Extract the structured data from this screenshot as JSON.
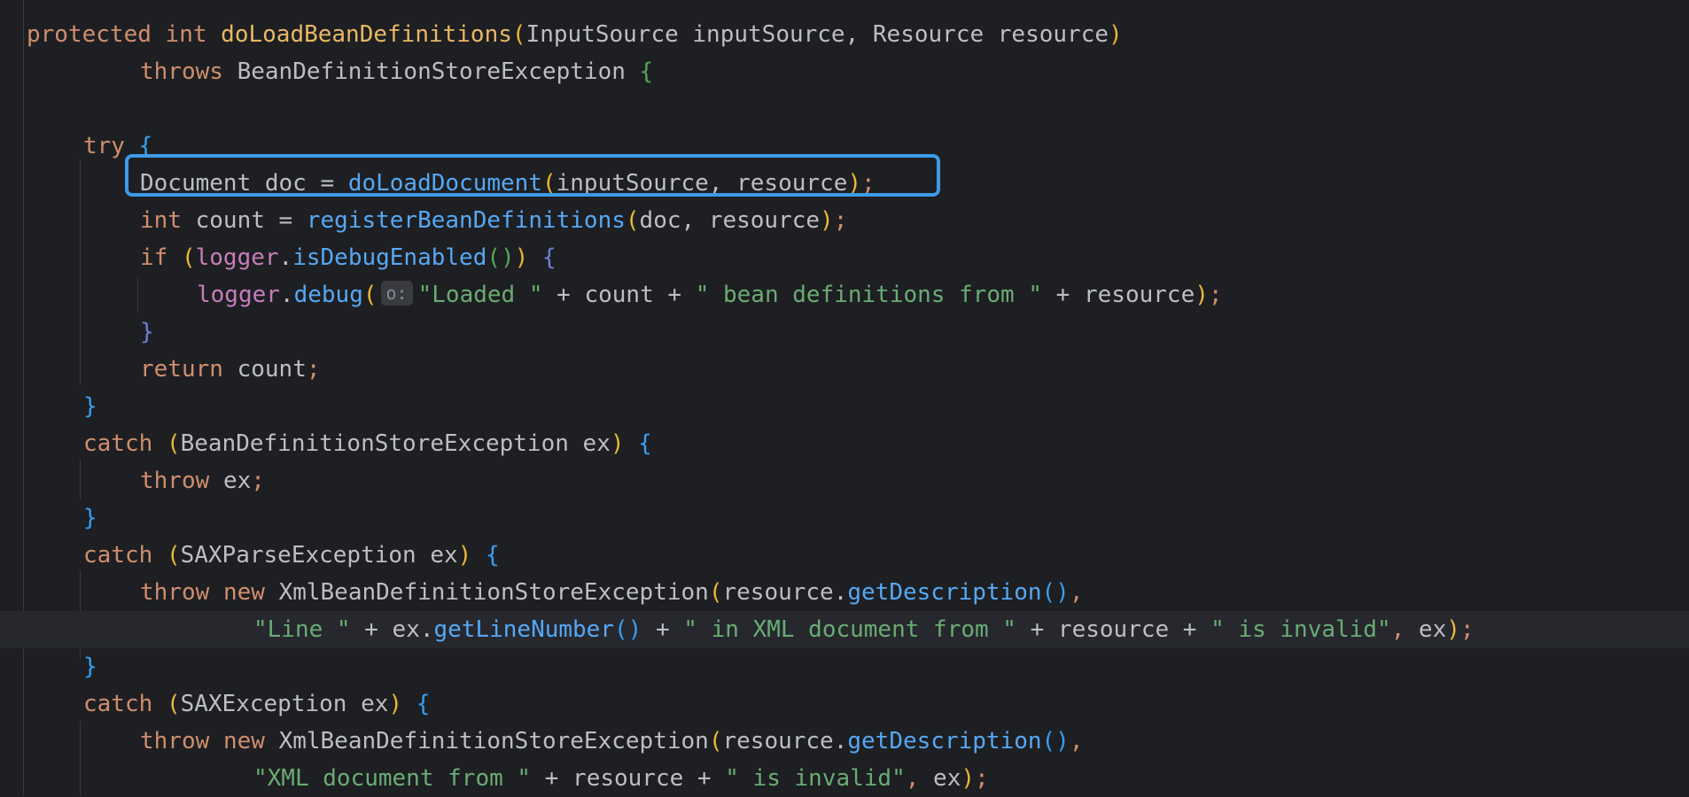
{
  "editor": {
    "lines": [
      "protected int doLoadBeanDefinitions(InputSource inputSource, Resource resource)",
      "throws BeanDefinitionStoreException {",
      "try {",
      "Document doc = doLoadDocument(inputSource, resource);",
      "int count = registerBeanDefinitions(doc, resource);",
      "if (logger.isDebugEnabled()) {",
      "logger.debug( o: \"Loaded \" + count + \" bean definitions from \" + resource);",
      "}",
      "return count;",
      "}",
      "catch (BeanDefinitionStoreException ex) {",
      "throw ex;",
      "}",
      "catch (SAXParseException ex) {",
      "throw new XmlBeanDefinitionStoreException(resource.getDescription(),",
      "\"Line \" + ex.getLineNumber() + \" in XML document from \" + resource + \" is invalid\", ex);",
      "}",
      "catch (SAXException ex) {",
      "throw new XmlBeanDefinitionStoreException(resource.getDescription(),",
      "\"XML document from \" + resource + \" is invalid\", ex);"
    ],
    "inlay_hint": "o:",
    "colors": {
      "background": "#1e1f22",
      "keyword": "#cf8e6d",
      "method_call": "#56a8f5",
      "method_declaration": "#e8b864",
      "string": "#6aab73",
      "field": "#c77dbb",
      "highlight_box": "#3d9be9"
    }
  }
}
